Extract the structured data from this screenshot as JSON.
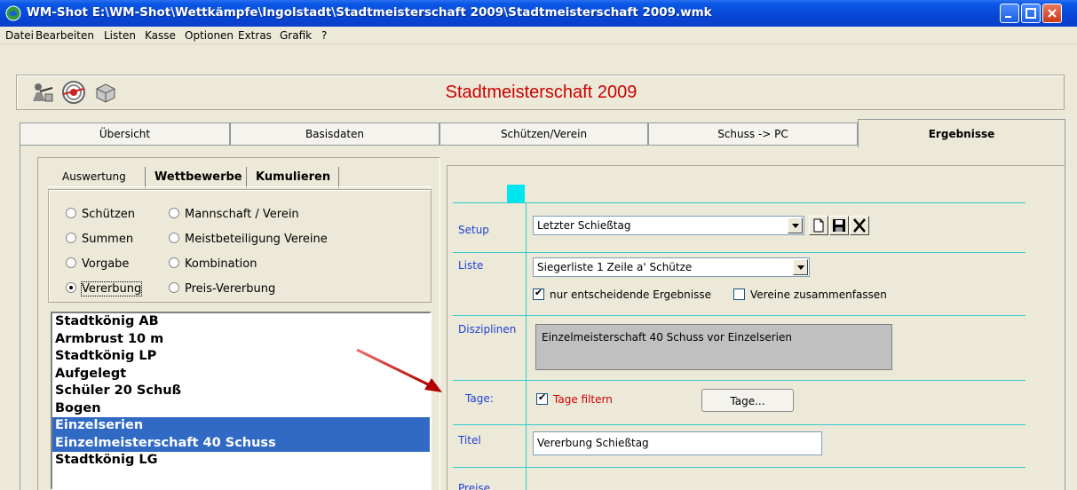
{
  "window": {
    "title": "WM-Shot E:\\WM-Shot\\Wettkämpfe\\Ingolstadt\\Stadtmeisterschaft 2009\\Stadtmeisterschaft 2009.wmk"
  },
  "menu": [
    "Datei",
    "Bearbeiten",
    "Listen",
    "Kasse",
    "Optionen",
    "Extras",
    "Grafik",
    "?"
  ],
  "toolbar": {
    "title": "Stadtmeisterschaft 2009",
    "title_color": "#cc0000",
    "icons": [
      "shooter-icon",
      "target-icon",
      "box-icon"
    ]
  },
  "tabs": [
    "Übersicht",
    "Basisdaten",
    "Schützen/Verein",
    "Schuss -> PC",
    "Ergebnisse"
  ],
  "active_tab": "Ergebnisse",
  "subtabs": [
    "Auswertung",
    "Wettbewerbe",
    "Kumulieren"
  ],
  "radios": [
    {
      "label": "Schützen",
      "checked": false
    },
    {
      "label": "Mannschaft / Verein",
      "checked": false
    },
    {
      "label": "Summen",
      "checked": false
    },
    {
      "label": "Meistbeteiligung Vereine",
      "checked": false
    },
    {
      "label": "Vorgabe",
      "checked": false
    },
    {
      "label": "Kombination",
      "checked": false
    },
    {
      "label": "Vererbung",
      "checked": true
    },
    {
      "label": "Preis-Vererbung",
      "checked": false
    }
  ],
  "list": {
    "items": [
      {
        "label": "Stadtkönig AB",
        "selected": false
      },
      {
        "label": "Armbrust 10 m",
        "selected": false
      },
      {
        "label": "Stadtkönig LP",
        "selected": false
      },
      {
        "label": "Aufgelegt",
        "selected": false
      },
      {
        "label": "Schüler 20 Schuß",
        "selected": false
      },
      {
        "label": "Bogen",
        "selected": false
      },
      {
        "label": "Einzelserien",
        "selected": true
      },
      {
        "label": "Einzelmeisterschaft 40 Schuss",
        "selected": true
      },
      {
        "label": "Stadtkönig LG",
        "selected": false
      }
    ],
    "selection_color": "#316AC5"
  },
  "form": {
    "setup_label": "Setup",
    "setup_value": "Letzter Schießtag",
    "liste_label": "Liste",
    "liste_value": "Siegerliste 1 Zeile a' Schütze",
    "checkbox_entscheidende": {
      "label": "nur entscheidende Ergebnisse",
      "checked": true
    },
    "checkbox_vereine": {
      "label": "Vereine zusammenfassen",
      "checked": false
    },
    "disziplinen_label": "Disziplinen",
    "disziplinen_value": "Einzelmeisterschaft 40 Schuss vor Einzelserien",
    "tage_label": "Tage:",
    "tage_filter": {
      "label": "Tage filtern",
      "checked": true
    },
    "tage_button": "Tage...",
    "titel_label": "Titel",
    "titel_value": "Vererbung Schießtag",
    "preise_label": "Preise",
    "label_color": "#1f3fd6",
    "accent_cyan": "#00e5ee"
  }
}
